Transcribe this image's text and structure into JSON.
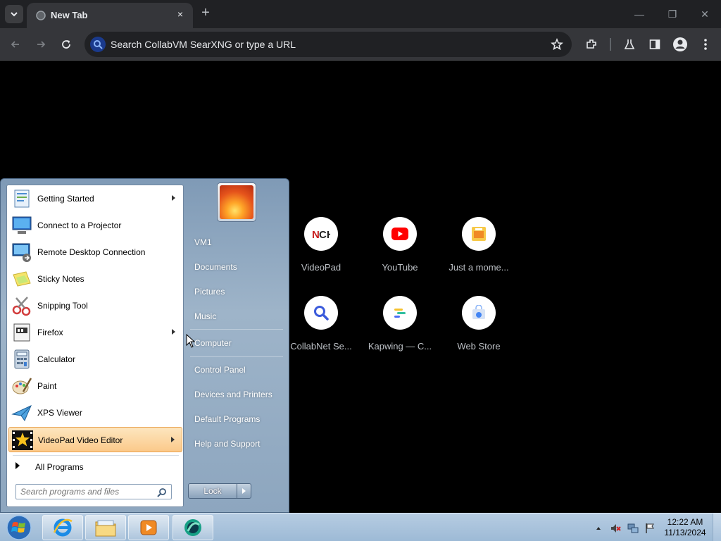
{
  "browser": {
    "tab_title": "New Tab",
    "tab_close": "×",
    "new_tab": "+",
    "omnibox_placeholder": "Search CollabVM SearXNG or type a URL",
    "window": {
      "minimize": "—",
      "restore": "❐",
      "close": "✕"
    }
  },
  "shortcuts": [
    {
      "label": "VideoPad",
      "icon": "videopad-nch-icon"
    },
    {
      "label": "YouTube",
      "icon": "youtube-icon"
    },
    {
      "label": "Just a mome...",
      "icon": "generic-site-icon"
    },
    {
      "label": "CollabNet Se...",
      "icon": "search-magnifier-icon"
    },
    {
      "label": "Kapwing — C...",
      "icon": "kapwing-icon"
    },
    {
      "label": "Web Store",
      "icon": "web-store-icon"
    }
  ],
  "start_menu": {
    "programs": [
      {
        "label": "Getting Started",
        "icon": "getting-started-icon",
        "submenu": true
      },
      {
        "label": "Connect to a Projector",
        "icon": "projector-icon",
        "submenu": false
      },
      {
        "label": "Remote Desktop Connection",
        "icon": "remote-desktop-icon",
        "submenu": false
      },
      {
        "label": "Sticky Notes",
        "icon": "sticky-notes-icon",
        "submenu": false
      },
      {
        "label": "Snipping Tool",
        "icon": "snipping-tool-icon",
        "submenu": false
      },
      {
        "label": "Firefox",
        "icon": "firefox-icon",
        "submenu": true
      },
      {
        "label": "Calculator",
        "icon": "calculator-icon",
        "submenu": false
      },
      {
        "label": "Paint",
        "icon": "paint-icon",
        "submenu": false
      },
      {
        "label": "XPS Viewer",
        "icon": "xps-viewer-icon",
        "submenu": false
      },
      {
        "label": "VideoPad Video Editor",
        "icon": "videopad-icon",
        "submenu": true,
        "highlighted": true
      }
    ],
    "all_programs": "All Programs",
    "search_placeholder": "Search programs and files",
    "right_items": [
      "VM1",
      "Documents",
      "Pictures",
      "Music",
      "Computer",
      "Control Panel",
      "Devices and Printers",
      "Default Programs",
      "Help and Support"
    ],
    "lock_label": "Lock"
  },
  "taskbar": {
    "pinned": [
      "internet-explorer-icon",
      "windows-explorer-icon",
      "media-player-icon",
      "chrome-like-icon"
    ],
    "clock_time": "12:22 AM",
    "clock_date": "11/13/2024"
  }
}
